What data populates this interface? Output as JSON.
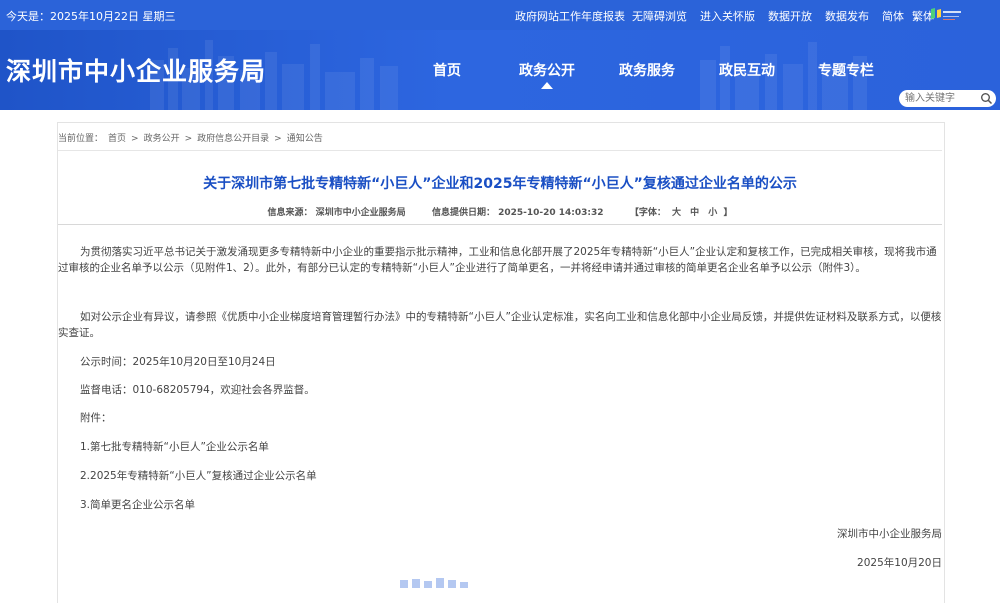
{
  "topbar": {
    "date": "今天是：2025年10月22日 星期三",
    "links": [
      "政府网站工作年度报表",
      "无障碍浏览",
      "进入关怀版",
      "数据开放",
      "数据发布",
      "简体",
      "繁体"
    ]
  },
  "header": {
    "site_title": "深圳市中小企业服务局",
    "nav": [
      "首页",
      "政务公开",
      "政务服务",
      "政民互动",
      "专题专栏"
    ],
    "active_nav": "政务公开",
    "search_placeholder": "输入关键字"
  },
  "breadcrumb": {
    "label": "当前位置：",
    "items": [
      "首页",
      "政务公开",
      "政府信息公开目录",
      "通知公告"
    ],
    "separator": ">"
  },
  "article": {
    "title": "关于深圳市第七批专精特新“小巨人”企业和2025年专精特新“小巨人”复核通过企业名单的公示",
    "source": "信息来源：  深圳市中小企业服务局",
    "time": "信息提供日期：  2025-10-20 14:03:32",
    "font_label": "【字体：",
    "font_sizes": [
      "大",
      "中",
      "小"
    ],
    "font_end": "】",
    "p1": "为贯彻落实习近平总书记关于激发涌现更多专精特新中小企业的重要指示批示精神，工业和信息化部开展了2025年专精特新“小巨人”企业认定和复核工作，已完成相关审核，现将我市通过审核的企业名单予以公示（见附件1、2）。此外，有部分已认定的专精特新“小巨人”企业进行了简单更名，一并将经申请并通过审核的简单更名企业名单予以公示（附件3）。",
    "p2": "如对公示企业有异议，请参照《优质中小企业梯度培育管理暂行办法》中的专精特新“小巨人”企业认定标准，实名向工业和信息化部中小企业局反馈，并提供佐证材料及联系方式，以便核实查证。",
    "period": "公示时间：2025年10月20日至10月24日",
    "phone": "监督电话：010-68205794，欢迎社会各界监督。",
    "attach_label": "附件：",
    "attachments": [
      "1.第七批专精特新“小巨人”企业公示名单",
      "2.2025年专精特新“小巨人”复核通过企业公示名单",
      "3.简单更名企业公示名单"
    ],
    "sign_org": "深圳市中小企业服务局",
    "sign_date": "2025年10月20日"
  },
  "colors": {
    "topbar": "#2b63d9",
    "header": "#2d66e0",
    "title": "#1a4fc4",
    "text": "#444444"
  },
  "icons": [
    "search-icon",
    "shenzhen-logo-icon"
  ]
}
